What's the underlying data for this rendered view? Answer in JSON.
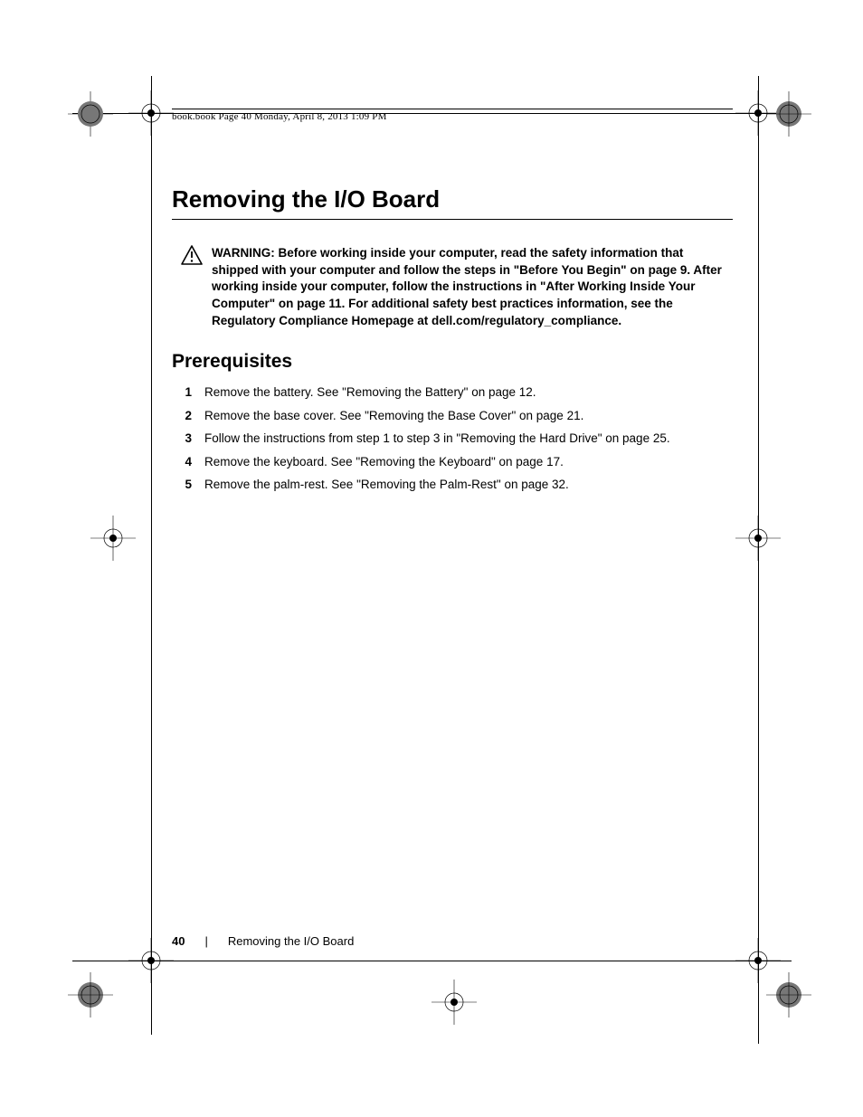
{
  "header": {
    "line": "book.book  Page 40  Monday, April 8, 2013  1:09 PM"
  },
  "title": "Removing the I/O Board",
  "warning": {
    "label": "WARNING:  ",
    "text": "Before working inside your computer, read the safety information that shipped with your computer and follow the steps in \"Before You Begin\" on page 9. After working inside your computer, follow the instructions in \"After Working Inside Your Computer\" on page 11. For additional safety best practices information, see the Regulatory Compliance Homepage at dell.com/regulatory_compliance."
  },
  "section_title": "Prerequisites",
  "steps": [
    "Remove the battery. See \"Removing the Battery\" on page 12.",
    "Remove the base cover. See \"Removing the Base Cover\" on page 21.",
    "Follow the instructions from step 1 to step 3 in \"Removing the Hard Drive\" on page 25.",
    "Remove the keyboard. See \"Removing the Keyboard\" on page 17.",
    "Remove the palm-rest. See \"Removing the Palm-Rest\" on page 32."
  ],
  "footer": {
    "page_number": "40",
    "separator": "|",
    "title": "Removing the I/O Board"
  }
}
